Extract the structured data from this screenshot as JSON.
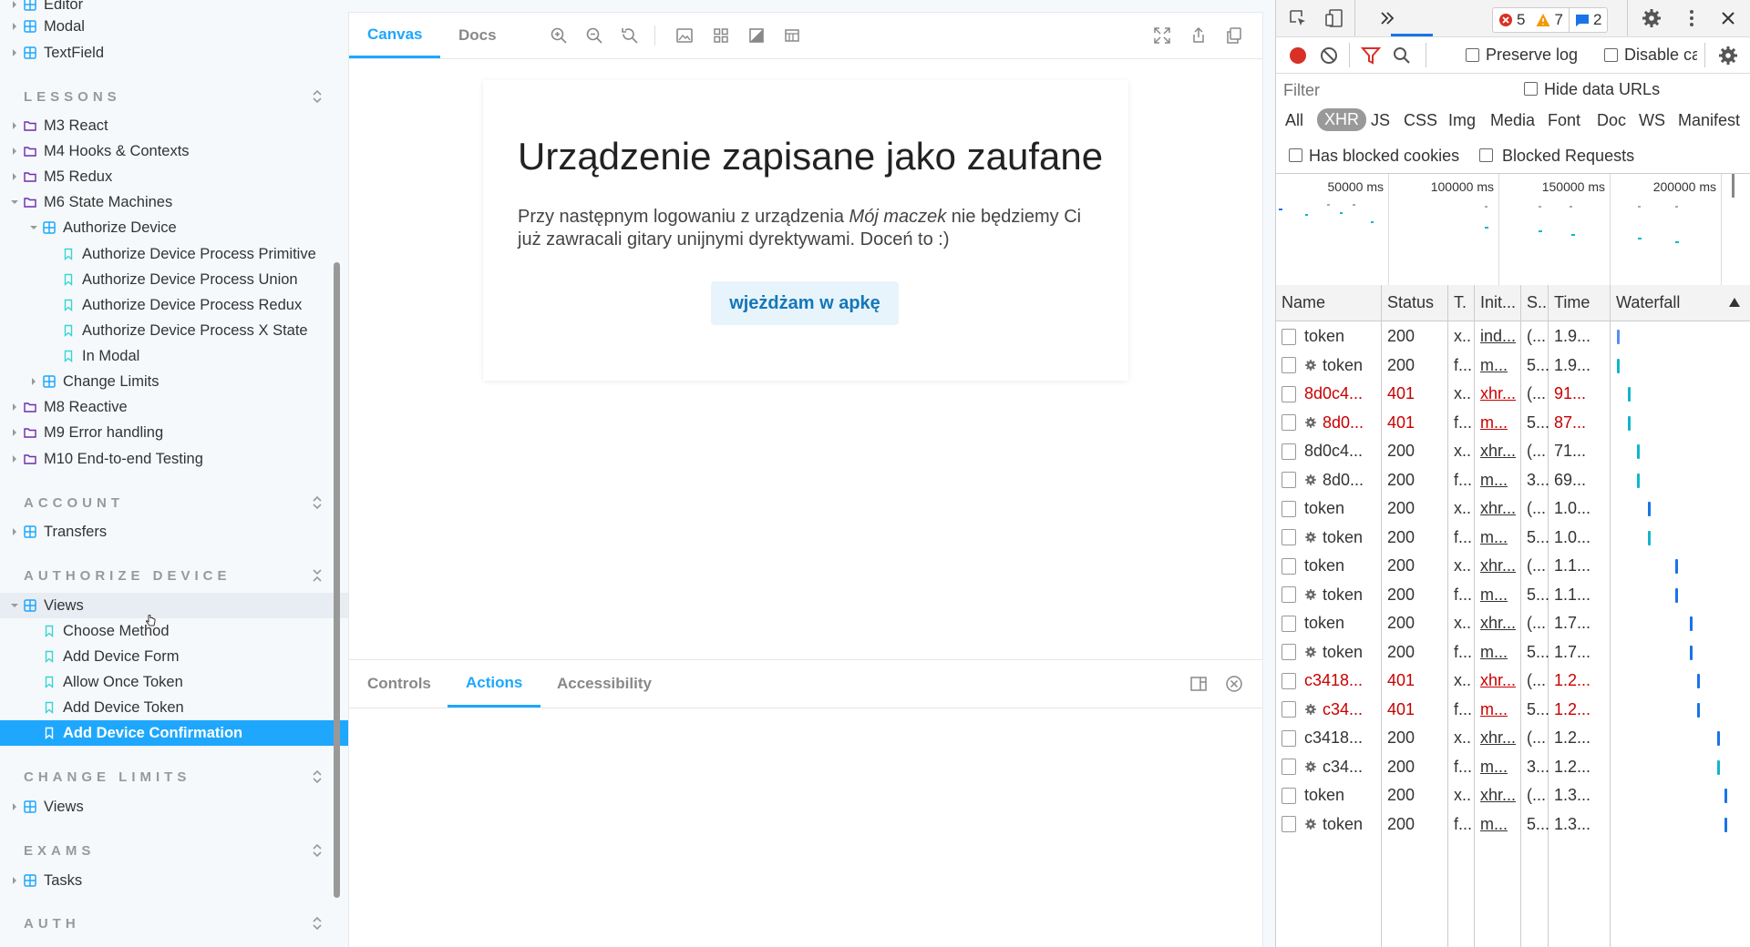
{
  "sidebar": {
    "top_items": [
      {
        "label": "Editor",
        "type": "component"
      },
      {
        "label": "Modal",
        "type": "component"
      },
      {
        "label": "TextField",
        "type": "component"
      }
    ],
    "sections": [
      {
        "title": "LESSONS"
      },
      {
        "title": "ACCOUNT"
      },
      {
        "title": "AUTHORIZE DEVICE"
      },
      {
        "title": "CHANGE LIMITS"
      },
      {
        "title": "EXAMS"
      },
      {
        "title": "AUTH"
      }
    ],
    "lessons": [
      "M3 React",
      "M4 Hooks & Contexts",
      "M5 Redux",
      "M6 State Machines",
      "Authorize Device",
      "Authorize Device Process Primitive",
      "Authorize Device Process Union",
      "Authorize Device Process Redux",
      "Authorize Device Process X State",
      "In Modal",
      "Change Limits",
      "M8 Reactive",
      "M9 Error handling",
      "M10 End-to-end Testing"
    ],
    "account": [
      "Transfers"
    ],
    "authorize_device": [
      "Views",
      "Choose Method",
      "Add Device Form",
      "Allow Once Token",
      "Add Device Token",
      "Add Device Confirmation"
    ],
    "change_limits": [
      "Views"
    ],
    "exams": [
      "Tasks"
    ]
  },
  "preview": {
    "tabs": [
      "Canvas",
      "Docs"
    ],
    "active_tab": "Canvas",
    "card": {
      "title": "Urządzenie zapisane jako zaufane",
      "text_before": "Przy następnym logowaniu z urządzenia ",
      "text_device": "Mój maczek",
      "text_after": " nie będziemy Ci już zawracali gitary unijnymi dyrektywami. Doceń to :)",
      "button": "wjeżdżam w apkę"
    },
    "addon_tabs": [
      "Controls",
      "Actions",
      "Accessibility"
    ],
    "active_addon": "Actions"
  },
  "devtools": {
    "badges": {
      "errors": "5",
      "warnings": "7",
      "messages": "2"
    },
    "preserve_log": "Preserve log",
    "disable_cache": "Disable ca",
    "filter_placeholder": "Filter",
    "hide_data_urls": "Hide data URLs",
    "types": [
      "All",
      "XHR",
      "JS",
      "CSS",
      "Img",
      "Media",
      "Font",
      "Doc",
      "WS",
      "Manifest"
    ],
    "active_type": "XHR",
    "has_blocked_cookies": "Has blocked cookies",
    "blocked_requests": "Blocked Requests",
    "timeline_labels": [
      "50000 ms",
      "100000 ms",
      "150000 ms",
      "200000 ms"
    ],
    "columns": [
      "Name",
      "Status",
      "T.",
      "Init...",
      "S...",
      "Time",
      "Waterfall"
    ],
    "requests": [
      {
        "name": "token",
        "gear": false,
        "status": "200",
        "type": "x..",
        "init": "ind...",
        "size": "(...",
        "time": "1.9...",
        "err": false
      },
      {
        "name": "token",
        "gear": true,
        "status": "200",
        "type": "f...",
        "init": "m...",
        "size": "5...",
        "time": "1.9...",
        "err": false
      },
      {
        "name": "8d0c4...",
        "gear": false,
        "status": "401",
        "type": "x..",
        "init": "xhr...",
        "size": "(...",
        "time": "91...",
        "err": true
      },
      {
        "name": "8d0...",
        "gear": true,
        "status": "401",
        "type": "f...",
        "init": "m...",
        "size": "5...",
        "time": "87...",
        "err": true
      },
      {
        "name": "8d0c4...",
        "gear": false,
        "status": "200",
        "type": "x..",
        "init": "xhr...",
        "size": "(...",
        "time": "71...",
        "err": false
      },
      {
        "name": "8d0...",
        "gear": true,
        "status": "200",
        "type": "f...",
        "init": "m...",
        "size": "3...",
        "time": "69...",
        "err": false
      },
      {
        "name": "token",
        "gear": false,
        "status": "200",
        "type": "x..",
        "init": "xhr...",
        "size": "(...",
        "time": "1.0...",
        "err": false
      },
      {
        "name": "token",
        "gear": true,
        "status": "200",
        "type": "f...",
        "init": "m...",
        "size": "5...",
        "time": "1.0...",
        "err": false
      },
      {
        "name": "token",
        "gear": false,
        "status": "200",
        "type": "x..",
        "init": "xhr...",
        "size": "(...",
        "time": "1.1...",
        "err": false
      },
      {
        "name": "token",
        "gear": true,
        "status": "200",
        "type": "f...",
        "init": "m...",
        "size": "5...",
        "time": "1.1...",
        "err": false
      },
      {
        "name": "token",
        "gear": false,
        "status": "200",
        "type": "x..",
        "init": "xhr...",
        "size": "(...",
        "time": "1.7...",
        "err": false
      },
      {
        "name": "token",
        "gear": true,
        "status": "200",
        "type": "f...",
        "init": "m...",
        "size": "5...",
        "time": "1.7...",
        "err": false
      },
      {
        "name": "c3418...",
        "gear": false,
        "status": "401",
        "type": "x..",
        "init": "xhr...",
        "size": "(...",
        "time": "1.2...",
        "err": true
      },
      {
        "name": "c34...",
        "gear": true,
        "status": "401",
        "type": "f...",
        "init": "m...",
        "size": "5...",
        "time": "1.2...",
        "err": true
      },
      {
        "name": "c3418...",
        "gear": false,
        "status": "200",
        "type": "x..",
        "init": "xhr...",
        "size": "(...",
        "time": "1.2...",
        "err": false
      },
      {
        "name": "c34...",
        "gear": true,
        "status": "200",
        "type": "f...",
        "init": "m...",
        "size": "3...",
        "time": "1.2...",
        "err": false
      },
      {
        "name": "token",
        "gear": false,
        "status": "200",
        "type": "x..",
        "init": "xhr...",
        "size": "(...",
        "time": "1.3...",
        "err": false
      },
      {
        "name": "token",
        "gear": true,
        "status": "200",
        "type": "f...",
        "init": "m...",
        "size": "5...",
        "time": "1.3...",
        "err": false
      }
    ]
  },
  "colors": {
    "accent": "#1ea7fd",
    "error": "#c80000",
    "record": "#d93025",
    "filter_red": "#d93025",
    "info_blue": "#1a73e8"
  }
}
